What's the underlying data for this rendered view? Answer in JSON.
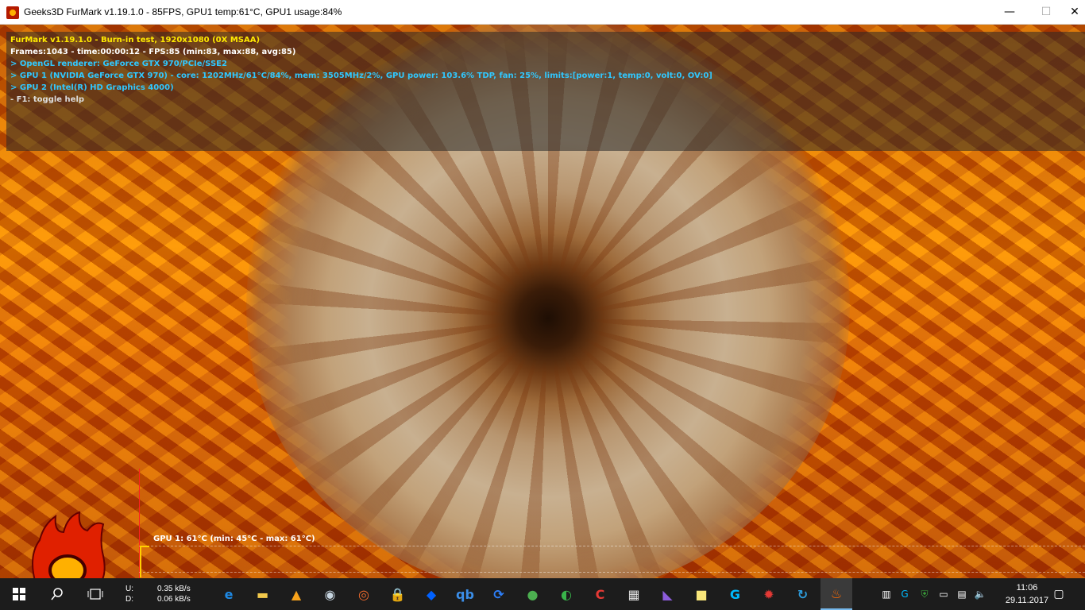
{
  "window": {
    "title": "Geeks3D FurMark v1.19.1.0 - 85FPS, GPU1 temp:61°C, GPU1 usage:84%",
    "minimize": "—",
    "maximize": "☐",
    "close": "✕"
  },
  "osd": {
    "line0": "FurMark v1.19.1.0 - Burn-in test, 1920x1080 (0X MSAA)",
    "line1": "Frames:1043 - time:00:00:12 - FPS:85 (min:83, max:88, avg:85)",
    "line2": "> OpenGL renderer: GeForce GTX 970/PCIe/SSE2",
    "line3": "> GPU 1 (NVIDIA GeForce GTX 970) - core: 1202MHz/61°C/84%, mem: 3505MHz/2%, GPU power: 103.6% TDP, fan: 25%, limits:[power:1, temp:0, volt:0, OV:0]",
    "line4": "> GPU 2 (Intel(R) HD Graphics 4000)",
    "line5": "- F1: toggle help"
  },
  "graph": {
    "label": "GPU 1: 61°C (min: 45°C - max: 61°C)"
  },
  "taskbar": {
    "start_icon": "windows-logo-icon",
    "search_icon": "search-icon",
    "taskview_icon": "task-view-icon",
    "net_upload_label": "U:",
    "net_download_label": "D:",
    "net_upload": "0.35 kB/s",
    "net_download": "0.06 kB/s",
    "apps": [
      {
        "name": "edge-icon",
        "glyph": "e",
        "color": "#1e8ae6"
      },
      {
        "name": "file-explorer-icon",
        "glyph": "▬",
        "color": "#f2c94c"
      },
      {
        "name": "avast-icon",
        "glyph": "▲",
        "color": "#f7a21b"
      },
      {
        "name": "steam-icon",
        "glyph": "◉",
        "color": "#c7d5e0"
      },
      {
        "name": "origin-icon",
        "glyph": "◎",
        "color": "#f56c2d"
      },
      {
        "name": "vpn-lock-icon",
        "glyph": "🔒",
        "color": "#9aa7b8"
      },
      {
        "name": "dropbox-icon",
        "glyph": "◆",
        "color": "#0061ff"
      },
      {
        "name": "qbittorrent-icon",
        "glyph": "qb",
        "color": "#3b8ee8"
      },
      {
        "name": "sync-icon",
        "glyph": "⟳",
        "color": "#2d7ff9"
      },
      {
        "name": "chrome-icon",
        "glyph": "●",
        "color": "#4caf50"
      },
      {
        "name": "web-globe-icon",
        "glyph": "◐",
        "color": "#39b54a"
      },
      {
        "name": "ccleaner-icon",
        "glyph": "C",
        "color": "#e53935"
      },
      {
        "name": "calculator-icon",
        "glyph": "▦",
        "color": "#e0e0e0"
      },
      {
        "name": "visual-studio-icon",
        "glyph": "◣",
        "color": "#8c5cdb"
      },
      {
        "name": "sticky-notes-icon",
        "glyph": "■",
        "color": "#f8e67a"
      },
      {
        "name": "logitech-g-icon",
        "glyph": "G",
        "color": "#00b8fc"
      },
      {
        "name": "bug-icon",
        "glyph": "✹",
        "color": "#e53935"
      },
      {
        "name": "update-icon",
        "glyph": "↻",
        "color": "#2d9cdb"
      },
      {
        "name": "furmark-icon",
        "glyph": "♨",
        "color": "#ff6a00"
      }
    ],
    "tray": {
      "time": "11:06",
      "date": "29.11.2017"
    }
  }
}
